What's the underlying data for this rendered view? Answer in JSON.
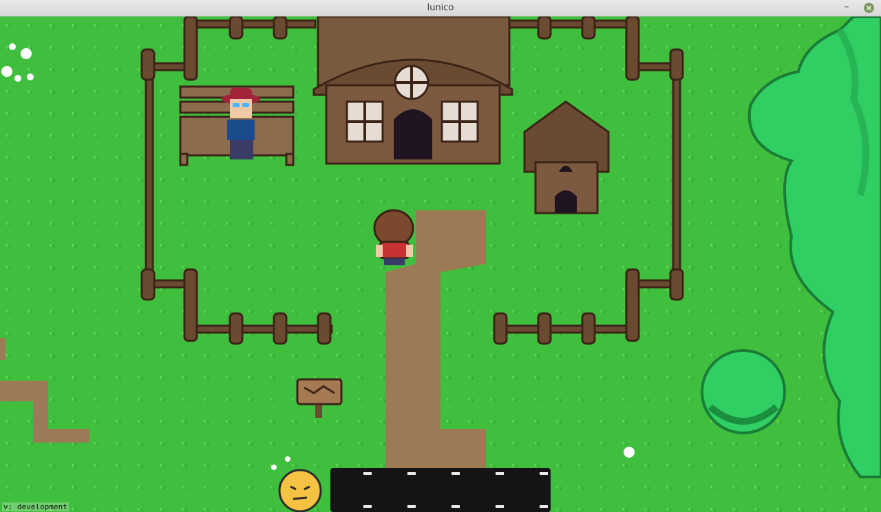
{
  "window": {
    "title": "lunico",
    "minimize_glyph": "–",
    "close_glyph": "×"
  },
  "hud": {
    "version_text": "v: development",
    "mood_icon": "neutral-face-icon",
    "inventory_slots": 5
  },
  "colors": {
    "grass": "#3fbf3d",
    "grass_dark": "#2fa531",
    "path": "#9c7a55",
    "wood": "#6b4a32",
    "wood_dark": "#3b2417",
    "tree": "#2fcf63",
    "tree_dark": "#1b8f3d",
    "face": "#f5c243",
    "inventory_bg": "#141414"
  }
}
